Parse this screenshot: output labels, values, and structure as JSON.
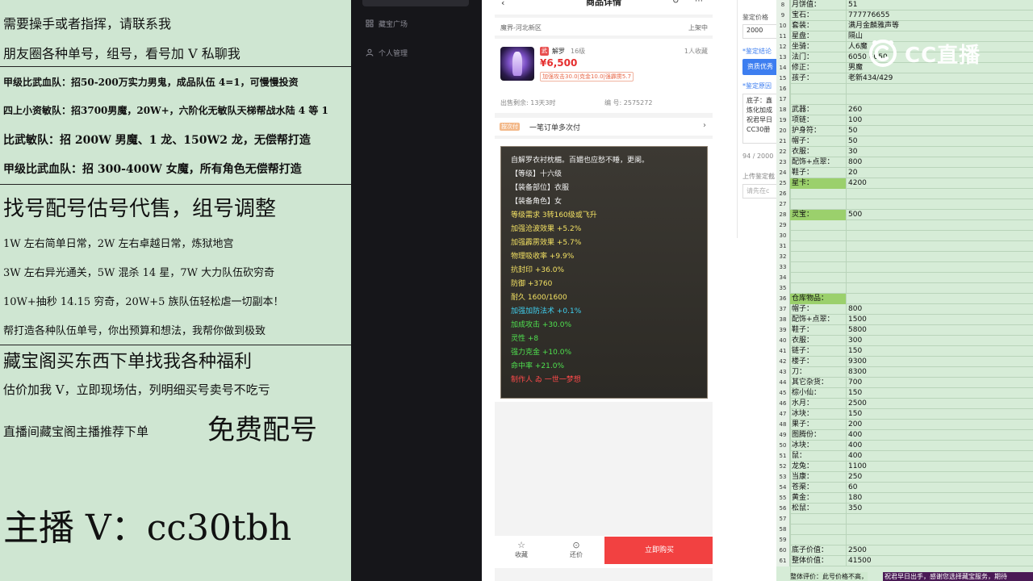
{
  "promo": {
    "lines": [
      "需要操手或者指挥，请联系我",
      "朋友圈各种单号，组号，看号加 V 私聊我",
      "甲级比武血队：招50-200万实力男鬼，成品队伍 4=1，可慢慢投资",
      "四上小资敏队：招3700男魔，20W+，六阶化无敏队天梯帮战水陆 4 等 1",
      "比武敏队：招 200W 男魔、1 龙、150W2 龙，无偿帮打造",
      "甲级比武血队：招 300-400W 女魔，所有角色无偿帮打造",
      "找号配号估号代售，组号调整",
      "1W 左右简单日常，2W 左右卓越日常，炼狱地宫",
      "3W 左右异光通关，5W 混杀 14 星，7W 大力队伍砍穷奇",
      "10W+抽秒 14.15 穷奇，20W+5 族队伍轻松虐一切副本！",
      "帮打造各种队伍单号，你出预算和想法，我帮你做到极致",
      "藏宝阁买东西下单找我各种福利",
      "估价加我 V，立即现场估，列明细买号卖号不吃亏",
      "直播间藏宝阁主播推荐下单",
      "免费配号",
      "主播 V：cc30tbh"
    ]
  },
  "sidebar": {
    "items": [
      "藏宝广场",
      "个人管理"
    ]
  },
  "phone": {
    "title": "商品详情",
    "back_icon": "‹",
    "share_icon": "↻",
    "more_icon": "⋯",
    "server": "魔界-河北新区",
    "status": "上架中",
    "item": {
      "badge": "武",
      "name": "解罗",
      "level": "16级",
      "interest": "1人收藏",
      "price": "¥6,500",
      "attrs": "加强攻击30.0|克金10.0|强霹雳5.7",
      "remaining": "出售剩余: 13天3时",
      "serial": "编 号: 2575272"
    },
    "order": {
      "badge": "按次付",
      "text": "一笔订单多次付",
      "chevron": "›"
    },
    "description": [
      {
        "text": "自解罗衣衬枕楣。百媚也应愁不睡，更阑。",
        "color": "#f2f2f2"
      },
      {
        "text": "【等级】十六级",
        "color": "#f2f2f2"
      },
      {
        "text": "【装备部位】衣服",
        "color": "#f2f2f2"
      },
      {
        "text": "【装备角色】女",
        "color": "#f2f2f2"
      },
      {
        "text": "等级需求 3转160级或飞升",
        "color": "#f3e163"
      },
      {
        "text": "加强沧波效果 +5.2%",
        "color": "#f3e163"
      },
      {
        "text": "加强霹雳效果 +5.7%",
        "color": "#f3e163"
      },
      {
        "text": "物理吸收率 +9.9%",
        "color": "#f3e163"
      },
      {
        "text": "抗封印 +36.0%",
        "color": "#f3e163"
      },
      {
        "text": "防御 +3760",
        "color": "#f3e163"
      },
      {
        "text": "耐久 1600/1600",
        "color": "#f3e163"
      },
      {
        "text": "加强加防法术 +0.1%",
        "color": "#3fd0f0"
      },
      {
        "text": "加成攻击 +30.0%",
        "color": "#4fe04f"
      },
      {
        "text": "灵性 +8",
        "color": "#4fe04f"
      },
      {
        "text": "强力克金 +10.0%",
        "color": "#4fe04f"
      },
      {
        "text": "命中率 +21.0%",
        "color": "#4fe04f"
      },
      {
        "text": "制作人 ゐ 一世一梦想",
        "color": "#ff4a4a"
      }
    ],
    "footer": {
      "fav_icon": "☆",
      "fav": "收藏",
      "bargain_icon": "⊙",
      "bargain": "还价",
      "buy": "立即购买"
    }
  },
  "appraise": {
    "price_label": "鉴定价格",
    "price_value": "2000",
    "conclusion_label": "*鉴定结论",
    "conclusion_btn": "资质优秀",
    "reason_label": "*鉴定原因",
    "reason_lines": [
      "底子：鑫",
      "炼化加成",
      "祝君早日",
      "CC30册"
    ],
    "count": "94 / 2000",
    "upload_label": "上传鉴定截",
    "upload_hint": "请先在c"
  },
  "sheet": {
    "rows": [
      {
        "n": "8",
        "a": "月饼值：",
        "b": "51"
      },
      {
        "n": "9",
        "a": "宝石：",
        "b": "777776655"
      },
      {
        "n": "10",
        "a": "套装：",
        "b": "满月金麟雅声等"
      },
      {
        "n": "11",
        "a": "星盘：",
        "b": "隔山"
      },
      {
        "n": "12",
        "a": "坐骑：",
        "b": "人6魔"
      },
      {
        "n": "13",
        "a": "法门：",
        "b": "6050 6050"
      },
      {
        "n": "14",
        "a": "修正：",
        "b": "男魔"
      },
      {
        "n": "15",
        "a": "孩子：",
        "b": "老新434/429"
      },
      {
        "n": "16",
        "a": "",
        "b": ""
      },
      {
        "n": "17",
        "a": "",
        "b": ""
      },
      {
        "n": "18",
        "a": "武器：",
        "b": "260"
      },
      {
        "n": "19",
        "a": "项链：",
        "b": "100"
      },
      {
        "n": "20",
        "a": "护身符：",
        "b": "50"
      },
      {
        "n": "21",
        "a": "帽子：",
        "b": "50"
      },
      {
        "n": "22",
        "a": "衣服：",
        "b": "30"
      },
      {
        "n": "23",
        "a": "配饰+点翠：",
        "b": "800"
      },
      {
        "n": "24",
        "a": "鞋子：",
        "b": "20"
      },
      {
        "n": "25",
        "a": "星卡：",
        "b": "4200",
        "hl": true
      },
      {
        "n": "26",
        "a": "",
        "b": ""
      },
      {
        "n": "27",
        "a": "",
        "b": ""
      },
      {
        "n": "28",
        "a": "灵宝：",
        "b": "500",
        "hl": true
      },
      {
        "n": "29",
        "a": "",
        "b": ""
      },
      {
        "n": "30",
        "a": "",
        "b": ""
      },
      {
        "n": "31",
        "a": "",
        "b": ""
      },
      {
        "n": "32",
        "a": "",
        "b": ""
      },
      {
        "n": "33",
        "a": "",
        "b": ""
      },
      {
        "n": "34",
        "a": "",
        "b": ""
      },
      {
        "n": "35",
        "a": "",
        "b": ""
      },
      {
        "n": "36",
        "a": "仓库物品：",
        "b": "",
        "hl": true
      },
      {
        "n": "37",
        "a": "帽子：",
        "b": "800"
      },
      {
        "n": "38",
        "a": "配饰+点翠：",
        "b": "1500"
      },
      {
        "n": "39",
        "a": "鞋子：",
        "b": "5800"
      },
      {
        "n": "40",
        "a": "衣服：",
        "b": "300"
      },
      {
        "n": "41",
        "a": "链子：",
        "b": "150"
      },
      {
        "n": "42",
        "a": "楼子：",
        "b": "9300"
      },
      {
        "n": "43",
        "a": "刀：",
        "b": "8300"
      },
      {
        "n": "44",
        "a": "其它杂货：",
        "b": "700"
      },
      {
        "n": "45",
        "a": "棕小仙：",
        "b": "150"
      },
      {
        "n": "46",
        "a": "水月：",
        "b": "2500"
      },
      {
        "n": "47",
        "a": "冰块：",
        "b": "150"
      },
      {
        "n": "48",
        "a": "果子：",
        "b": "200"
      },
      {
        "n": "49",
        "a": "图腾份：",
        "b": "400"
      },
      {
        "n": "50",
        "a": "冰块：",
        "b": "400"
      },
      {
        "n": "51",
        "a": "鼠：",
        "b": "400"
      },
      {
        "n": "52",
        "a": "龙兔：",
        "b": "1100"
      },
      {
        "n": "53",
        "a": "当康：",
        "b": "250"
      },
      {
        "n": "54",
        "a": "苍渠：",
        "b": "60"
      },
      {
        "n": "55",
        "a": "黄金：",
        "b": "180"
      },
      {
        "n": "56",
        "a": "松鼠：",
        "b": "350"
      },
      {
        "n": "57",
        "a": "",
        "b": ""
      },
      {
        "n": "58",
        "a": "",
        "b": ""
      },
      {
        "n": "59",
        "a": "",
        "b": ""
      },
      {
        "n": "60",
        "a": "底子价值：",
        "b": "2500"
      },
      {
        "n": "61",
        "a": "整体价值：",
        "b": "41500"
      }
    ],
    "bottom_label": "整体评价：此号价格不高，",
    "bottom_note": "祝君早日出手，感谢您选择藏宝服务，期待"
  },
  "watermark": {
    "text": "CC直播",
    "icon": "cc-logo-icon"
  }
}
